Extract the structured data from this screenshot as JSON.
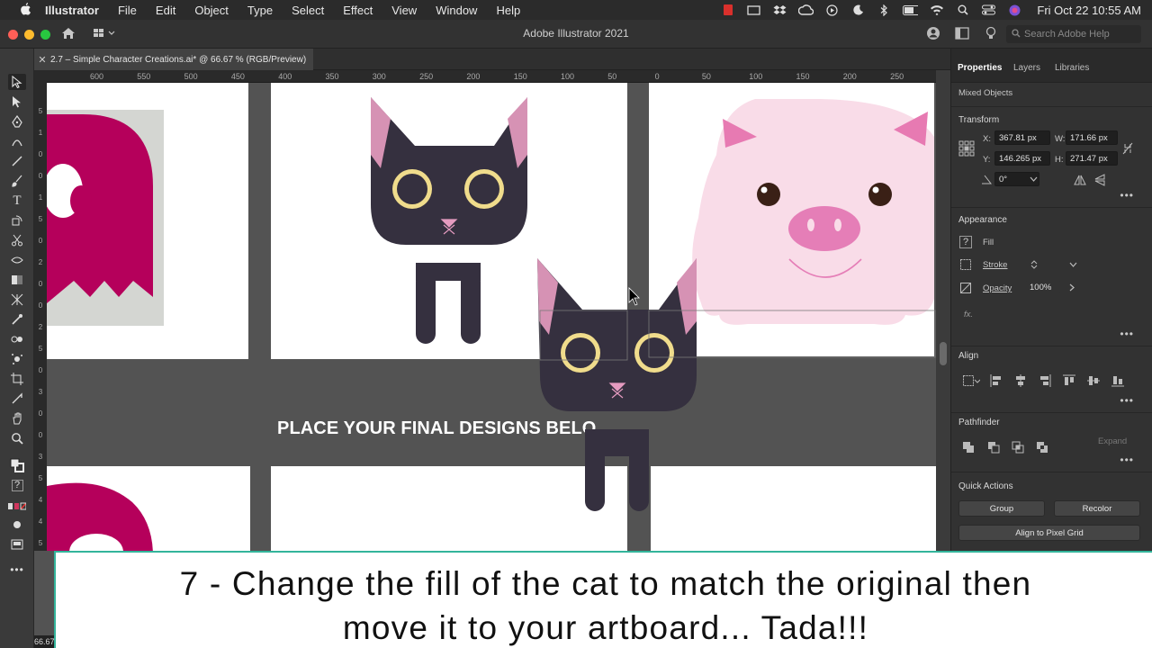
{
  "menubar": {
    "apple_icon": "apple-icon",
    "items": [
      "Illustrator",
      "File",
      "Edit",
      "Object",
      "Type",
      "Select",
      "Effect",
      "View",
      "Window",
      "Help"
    ],
    "status_icons": [
      "record-icon",
      "screen-icon",
      "dropbox-icon",
      "creative-cloud-icon",
      "play-icon",
      "moon-icon",
      "bluetooth-icon",
      "battery-icon",
      "wifi-icon",
      "search-icon",
      "control-center-icon",
      "siri-icon"
    ],
    "clock": "Fri Oct 22  10:55 AM"
  },
  "appbar": {
    "title": "Adobe Illustrator 2021",
    "search_placeholder": "Search Adobe Help"
  },
  "document": {
    "tab_title": "2.7 – Simple Character Creations.ai* @ 66.67 % (RGB/Preview)",
    "close_icon": "close-icon"
  },
  "ruler": {
    "h_ticks": [
      "600",
      "550",
      "500",
      "450",
      "400",
      "350",
      "300",
      "250",
      "200",
      "150",
      "100",
      "50",
      "0",
      "50",
      "100",
      "150",
      "200",
      "250"
    ],
    "v_ticks": [
      "5",
      "1",
      "0",
      "0",
      "1",
      "5",
      "0",
      "2",
      "0",
      "0",
      "2",
      "5",
      "0",
      "3",
      "0",
      "0",
      "3",
      "5",
      "4",
      "4",
      "5"
    ]
  },
  "canvas": {
    "banner": "PLACE YOUR FINAL DESIGNS BELO",
    "colors": {
      "ghost": "#b5005b",
      "cat_body": "#35303f",
      "cat_ear": "#d692b4",
      "cat_eye_ring": "#f0dc8c",
      "cat_nose": "#e59bc0",
      "pig_body": "#f9dce8",
      "pig_ear": "#e77ab2",
      "pig_snout": "#e57eb7",
      "pig_eye": "#3a2016"
    }
  },
  "properties": {
    "tabs": [
      "Properties",
      "Layers",
      "Libraries"
    ],
    "selection_type": "Mixed Objects",
    "transform": {
      "header": "Transform",
      "x_label": "X:",
      "x_value": "367.81 px",
      "y_label": "Y:",
      "y_value": "146.265 px",
      "w_label": "W:",
      "w_value": "171.66 px",
      "h_label": "H:",
      "h_value": "271.47 px",
      "rotate_value": "0°"
    },
    "appearance": {
      "header": "Appearance",
      "fill_label": "Fill",
      "stroke_label": "Stroke",
      "opacity_label": "Opacity",
      "opacity_value": "100%",
      "fx_label": "fx."
    },
    "align": {
      "header": "Align"
    },
    "pathfinder": {
      "header": "Pathfinder",
      "expand_label": "Expand"
    },
    "quick_actions": {
      "header": "Quick Actions",
      "group_label": "Group",
      "recolor_label": "Recolor",
      "pixel_grid_label": "Align to Pixel Grid"
    }
  },
  "caption": {
    "line1": "7 - Change the fill of the cat to match the original then",
    "line2": "move it to your artboard... Tada!!!"
  },
  "zoom_label": "66.67"
}
